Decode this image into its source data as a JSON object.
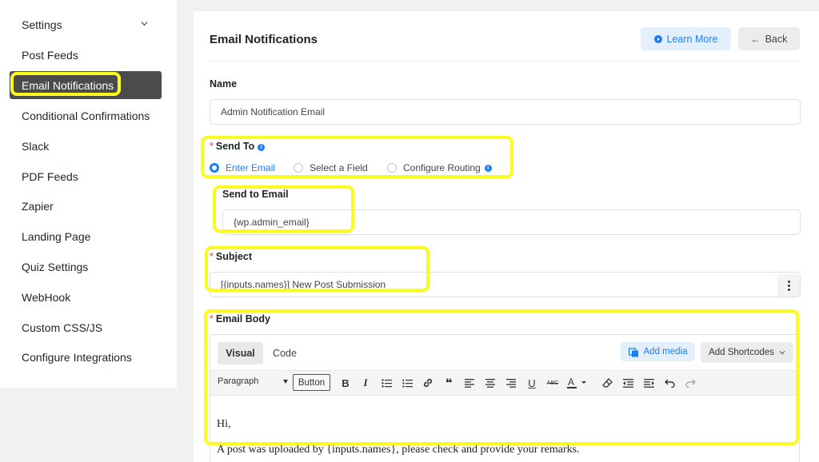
{
  "sidebar": {
    "items": [
      {
        "label": "Settings"
      },
      {
        "label": "Post Feeds"
      },
      {
        "label": "Email Notifications"
      },
      {
        "label": "Conditional Confirmations"
      },
      {
        "label": "Slack"
      },
      {
        "label": "PDF Feeds"
      },
      {
        "label": "Zapier"
      },
      {
        "label": "Landing Page"
      },
      {
        "label": "Quiz Settings"
      },
      {
        "label": "WebHook"
      },
      {
        "label": "Custom CSS/JS"
      },
      {
        "label": "Configure Integrations"
      }
    ],
    "active": "Email Notifications"
  },
  "header": {
    "title": "Email Notifications",
    "learn_more": "Learn More",
    "back": "Back",
    "back_arrow": "←"
  },
  "form": {
    "name_label": "Name",
    "name_value": "Admin Notification Email",
    "required_mark": "*",
    "send_to_label": "Send To",
    "info_mark": "i",
    "send_to_options": [
      "Enter Email",
      "Select a Field",
      "Configure Routing"
    ],
    "send_to_selected": "Enter Email",
    "send_to_email_label": "Send to Email",
    "send_to_email_value": "{wp.admin_email}",
    "subject_label": "Subject",
    "subject_value": "[{inputs.names}] New Post Submission",
    "email_body_label": "Email Body"
  },
  "editor": {
    "tabs": [
      "Visual",
      "Code"
    ],
    "active_tab": "Visual",
    "add_media": "Add media",
    "add_shortcodes": "Add Shortcodes",
    "paragraph": "Paragraph",
    "button_label": "Button",
    "body_lines": [
      "Hi,",
      "A post was uploaded by {inputs.names}, please check and provide your remarks."
    ]
  },
  "colors": {
    "accent": "#1a7efb",
    "highlight": "#fbfb1e",
    "active_sidebar": "#4b4b4b",
    "required": "#e34a4a"
  }
}
